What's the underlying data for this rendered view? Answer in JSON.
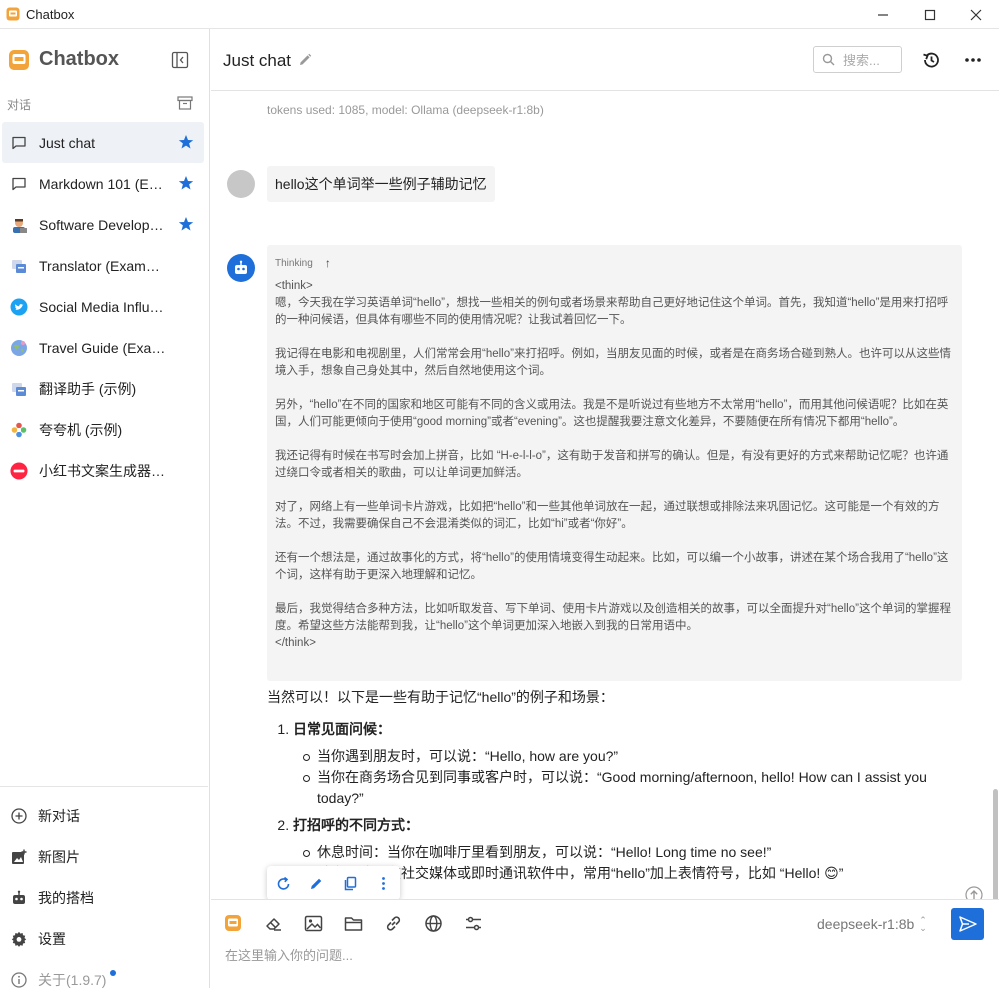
{
  "window": {
    "title": "Chatbox"
  },
  "sidebar": {
    "brand": "Chatbox",
    "section_label": "对话",
    "conversations": [
      {
        "label": "Just chat",
        "icon": "chat-bubble-icon",
        "starred": true,
        "active": true
      },
      {
        "label": "Markdown 101 (Example)",
        "icon": "chat-bubble-icon",
        "starred": true
      },
      {
        "label": "Software Developer (Example)",
        "icon": "developer-avatar-icon",
        "starred": true
      },
      {
        "label": "Translator (Example)",
        "icon": "translator-avatar-icon"
      },
      {
        "label": "Social Media Influencer (Example)",
        "icon": "twitter-avatar-icon"
      },
      {
        "label": "Travel Guide (Example)",
        "icon": "globe-avatar-icon"
      },
      {
        "label": "翻译助手 (示例)",
        "icon": "translator-avatar-icon"
      },
      {
        "label": "夸夸机 (示例)",
        "icon": "flower-avatar-icon"
      },
      {
        "label": "小红书文案生成器 (示例)",
        "icon": "xiaohongshu-avatar-icon"
      }
    ],
    "bottom_menu": {
      "new_chat": "新对话",
      "new_image": "新图片",
      "my_partner": "我的搭档",
      "settings": "设置",
      "about": "关于(1.9.7)"
    }
  },
  "header": {
    "title": "Just chat",
    "search_placeholder": "搜索..."
  },
  "messages": {
    "prev_meta": "tokens used: 1085, model: Ollama (deepseek-r1:8b)",
    "user_message": "hello这个单词举一些例子辅助记忆",
    "thinking": {
      "label": "Thinking",
      "open_tag": "<think>",
      "paragraphs": [
        "嗯，今天我在学习英语单词“hello”，想找一些相关的例句或者场景来帮助自己更好地记住这个单词。首先，我知道“hello”是用来打招呼的一种问候语，但具体有哪些不同的使用情况呢？让我试着回忆一下。",
        "我记得在电影和电视剧里，人们常常会用“hello”来打招呼。例如，当朋友见面的时候，或者是在商务场合碰到熟人。也许可以从这些情境入手，想象自己身处其中，然后自然地使用这个词。",
        "另外，“hello”在不同的国家和地区可能有不同的含义或用法。我是不是听说过有些地方不太常用“hello”，而用其他问候语呢？比如在英国，人们可能更倾向于使用“good morning”或者“evening”。这也提醒我要注意文化差异，不要随便在所有情况下都用“hello”。",
        "我还记得有时候在书写时会加上拼音，比如 “H-e-l-l-o”，这有助于发音和拼写的确认。但是，有没有更好的方式来帮助记忆呢？也许通过绕口令或者相关的歌曲，可以让单词更加鲜活。",
        "对了，网络上有一些单词卡片游戏，比如把“hello”和一些其他单词放在一起，通过联想或排除法来巩固记忆。这可能是一个有效的方法。不过，我需要确保自己不会混淆类似的词汇，比如“hi”或者“你好”。",
        "还有一个想法是，通过故事化的方式，将“hello”的使用情境变得生动起来。比如，可以编一个小故事，讲述在某个场合我用了“hello”这个词，这样有助于更深入地理解和记忆。",
        "最后，我觉得结合多种方法，比如听取发音、写下单词、使用卡片游戏以及创造相关的故事，可以全面提升对“hello”这个单词的掌握程度。希望这些方法能帮到我，让“hello”这个单词更加深入地嵌入到我的日常用语中。"
      ],
      "close_tag": "</think>"
    },
    "answer": {
      "intro": "当然可以！以下是一些有助于记忆“hello”的例子和场景：",
      "sections": [
        {
          "heading": "日常见面问候：",
          "items": [
            "当你遇到朋友时，可以说：“Hello, how are you?”",
            "当你在商务场合见到同事或客户时，可以说：“Good morning/afternoon, hello! How can I assist you today?”"
          ]
        },
        {
          "heading": "打招呼的不同方式：",
          "items": [
            "休息时间：当你在咖啡厅里看到朋友，可以说：“Hello! Long time no see!”",
            "社交媒体：在社交媒体或即时通讯软件中，常用“hello”加上表情符号，比如 “Hello! 😊”"
          ]
        }
      ]
    }
  },
  "composer": {
    "model": "deepseek-r1:8b",
    "placeholder": "在这里输入你的问题..."
  },
  "colors": {
    "accent": "#1e6fd9",
    "active_bg": "#eef1f5",
    "thinking_bg": "#f4f4f4"
  }
}
